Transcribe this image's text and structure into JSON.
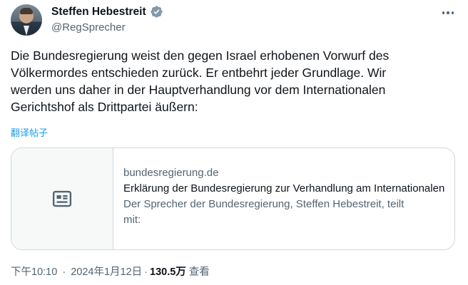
{
  "author": {
    "display_name": "Steffen Hebestreit",
    "handle": "@RegSprecher",
    "verified_badge_color": "#829aab"
  },
  "tweet": {
    "lines": [
      "Die Bundesregierung weist den gegen Israel erhobenen Vorwurf des",
      "Völkermordes entschieden zurück. Er entbehrt jeder Grundlage. Wir",
      "werden uns daher in der Hauptverhandlung vor dem Internationalen",
      "Gerichtshof als Drittpartei äußern:"
    ],
    "translate_label": "翻译帖子"
  },
  "card": {
    "domain": "bundesregierung.de",
    "title": "Erklärung der Bundesregierung zur Verhandlung am Internationalen",
    "description_lines": [
      "Der Sprecher der Bundesregierung, Steffen Hebestreit, teilt",
      "mit:"
    ],
    "thumbnail_icon": "newspaper-icon"
  },
  "meta": {
    "time": "下午10:10",
    "date": "2024年1月12日",
    "views_count": "130.5万",
    "views_label": "查看",
    "separator": "·"
  },
  "colors": {
    "accent": "#1d9bf0",
    "text_primary": "#0f1419",
    "text_secondary": "#536471",
    "border": "#cfd9de"
  }
}
